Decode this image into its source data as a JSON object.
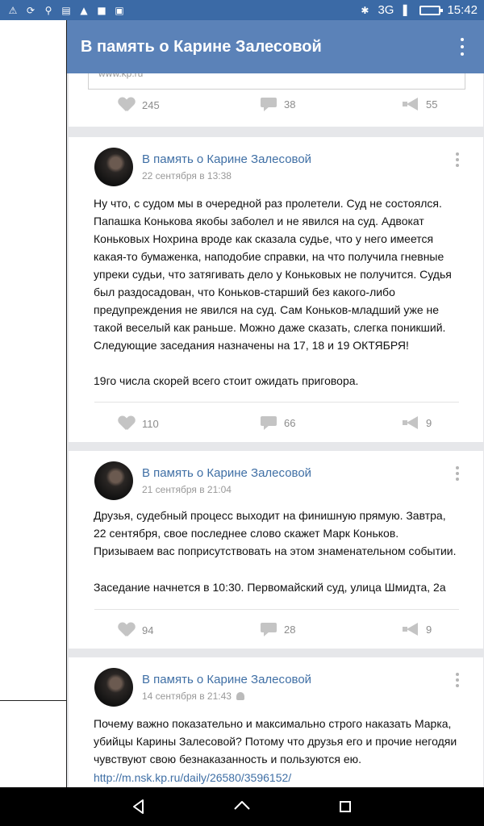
{
  "status_bar": {
    "network": "3G",
    "time": "15:42",
    "icons": [
      "warning-icon",
      "sync-icon",
      "search-icon",
      "notes-icon",
      "alert-icon",
      "lock-icon",
      "work-icon",
      "bluetooth-icon",
      "signal-icon",
      "battery-icon"
    ]
  },
  "app_bar": {
    "title": "В память о Карине Залесовой",
    "menu_icon": "more-vert-icon"
  },
  "posts": [
    {
      "url_preview": "www.kp.ru",
      "likes": "245",
      "comments": "38",
      "shares": "55"
    },
    {
      "author": "В память о Карине Залесовой",
      "date": "22 сентября в 13:38",
      "text": "Ну что, с судом мы в очередной раз пролетели. Суд не состоялся. Папашка Конькова якобы заболел и не явился на суд. Адвокат Коньковых Нохрина вроде как сказала судье, что у него имеется какая-то бумаженка, наподобие справки, на что получила гневные упреки судьи, что затягивать дело у Коньковых не получится. Судья был раздосадован, что Коньков-старший без какого-либо предупреждения не явился на суд. Сам Коньков-младший уже не такой веселый как раньше. Можно даже сказать, слегка поникший. Следующие заседания назначены на 17, 18 и 19 ОКТЯБРЯ!",
      "text2": "19го числа скорей всего стоит ожидать приговора.",
      "likes": "110",
      "comments": "66",
      "shares": "9"
    },
    {
      "author": "В память о Карине Залесовой",
      "date": "21 сентября в 21:04",
      "text": "Друзья, судебный процесс выходит на финишную прямую. Завтра, 22 сентября, свое последнее слово скажет Марк Коньков. Призываем вас поприсутствовать на этом знаменательном событии.",
      "text2": "Заседание начнется в 10:30. Первомайский суд, улица Шмидта, 2а",
      "likes": "94",
      "comments": "28",
      "shares": "9"
    },
    {
      "author": "В память о Карине Залесовой",
      "date": "14 сентября в 21:43",
      "text": "Почему важно показательно и максимально строго наказать Марка, убийцы Карины Залесовой? Потому что друзья его и прочие негодяи чувствуют свою безнаказанность и пользуются ею.",
      "link": "http://m.nsk.kp.ru/daily/26580/3596152/"
    }
  ]
}
